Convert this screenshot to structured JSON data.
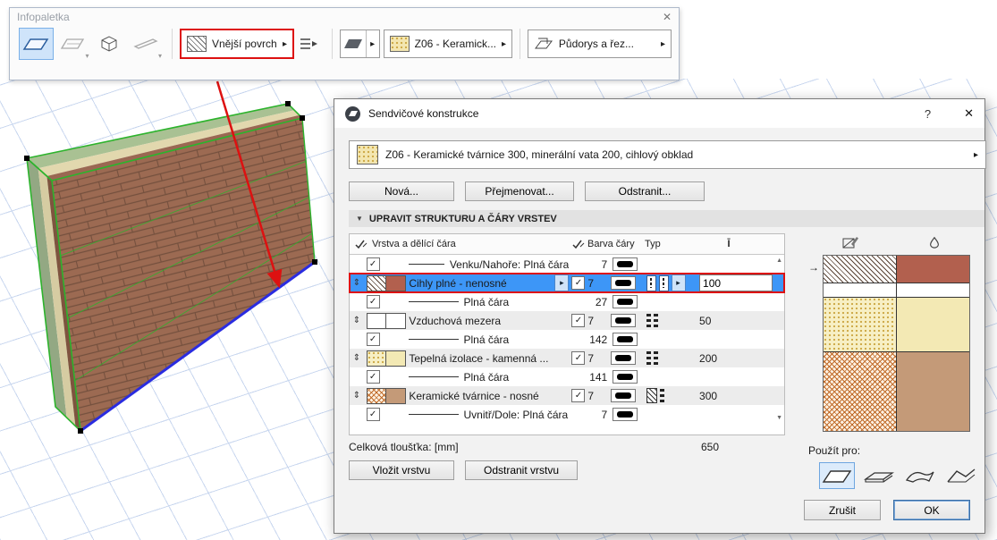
{
  "colors": {
    "selection_blue": "#3d96f7",
    "highlight_red": "#dd1111",
    "grid_blue": "#c9d7ef",
    "pen_black": "#000000"
  },
  "icons": {
    "close": "✕",
    "help": "?",
    "arrow_right": "▸",
    "dropdown_down": "▾",
    "collapse": "▼",
    "drag_handle": "⇕",
    "check": "✓",
    "scroll_up": "▲",
    "scroll_down": "▼",
    "apply_arrow": "→",
    "thickness_header": "Ī"
  },
  "infopalette": {
    "title": "Infopaletka",
    "surface_combo": "Vnější povrch",
    "composite_combo": "Z06 - Keramick...",
    "view_combo": "Půdorys a řez..."
  },
  "dialog": {
    "title": "Sendvičové konstrukce",
    "composite_select": "Z06 - Keramické tvárnice 300, minerální vata 200, cihlový obklad",
    "actions": {
      "new": "Nová...",
      "rename": "Přejmenovat...",
      "delete": "Odstranit..."
    },
    "section_header": "UPRAVIT STRUKTURU A ČÁRY VRSTEV",
    "table": {
      "col_layer": "Vrstva a dělící čára",
      "col_color": "Barva čáry",
      "col_type": "Typ",
      "rows": [
        {
          "kind": "contour",
          "name": "Venku/Nahoře: Plná čára",
          "pen": "7",
          "checked": true
        },
        {
          "kind": "layer",
          "name": "Cihly plné - nenosné",
          "pen": "7",
          "thickness": "100",
          "selected": true
        },
        {
          "kind": "contour",
          "name": "Plná čára",
          "pen": "27",
          "checked": true
        },
        {
          "kind": "layer",
          "name": "Vzduchová mezera",
          "pen": "7",
          "thickness": "50"
        },
        {
          "kind": "contour",
          "name": "Plná čára",
          "pen": "142",
          "checked": true
        },
        {
          "kind": "layer",
          "name": "Tepelná izolace - kamenná ...",
          "pen": "7",
          "thickness": "200"
        },
        {
          "kind": "contour",
          "name": "Plná čára",
          "pen": "141",
          "checked": true
        },
        {
          "kind": "layer",
          "name": "Keramické tvárnice - nosné",
          "pen": "7",
          "thickness": "300"
        },
        {
          "kind": "contour",
          "name": "Uvnitř/Dole: Plná čára",
          "pen": "7",
          "checked": true
        }
      ]
    },
    "total_label": "Celková tloušťka: [mm]",
    "total_value": "650",
    "layer_buttons": {
      "insert": "Vložit vrstvu",
      "remove": "Odstranit vrstvu"
    },
    "apply_label": "Použít pro:",
    "footer": {
      "cancel": "Zrušit",
      "ok": "OK"
    }
  }
}
